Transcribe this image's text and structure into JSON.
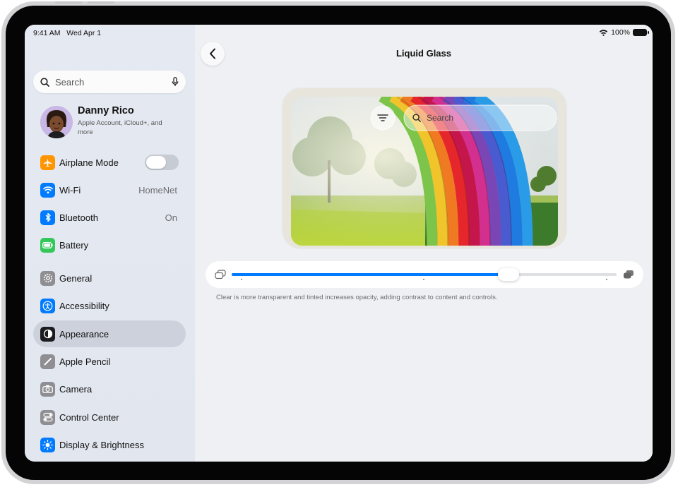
{
  "status": {
    "time": "9:41 AM",
    "date": "Wed Apr 1",
    "battery": "100%"
  },
  "sidebar": {
    "search_placeholder": "Search",
    "profile": {
      "name": "Danny Rico",
      "subtitle": "Apple Account, iCloud+, and more"
    },
    "items": [
      {
        "label": "Airplane Mode",
        "icon": "airplane-icon",
        "color": "#ff9500",
        "toggle": false
      },
      {
        "label": "Wi-Fi",
        "icon": "wifi-icon",
        "color": "#007aff",
        "value": "HomeNet"
      },
      {
        "label": "Bluetooth",
        "icon": "bluetooth-icon",
        "color": "#007aff",
        "value": "On"
      },
      {
        "label": "Battery",
        "icon": "battery-icon",
        "color": "#34c759"
      },
      {
        "label": "General",
        "icon": "gear-icon",
        "color": "#8e8e93"
      },
      {
        "label": "Accessibility",
        "icon": "accessibility-icon",
        "color": "#007aff"
      },
      {
        "label": "Appearance",
        "icon": "appearance-icon",
        "color": "#1c1c1e",
        "selected": true
      },
      {
        "label": "Apple Pencil",
        "icon": "pencil-icon",
        "color": "#8e8e93"
      },
      {
        "label": "Camera",
        "icon": "camera-icon",
        "color": "#8e8e93"
      },
      {
        "label": "Control Center",
        "icon": "control-center-icon",
        "color": "#8e8e93"
      },
      {
        "label": "Display & Brightness",
        "icon": "sun-icon",
        "color": "#007aff"
      }
    ]
  },
  "main": {
    "title": "Liquid Glass",
    "preview_search_placeholder": "Search",
    "slider": {
      "value": 0.72,
      "min_icon": "clear-glass-icon",
      "max_icon": "tinted-glass-icon",
      "accent": "#007aff"
    },
    "caption": "Clear is more transparent and tinted increases opacity, adding contrast to content and controls."
  }
}
